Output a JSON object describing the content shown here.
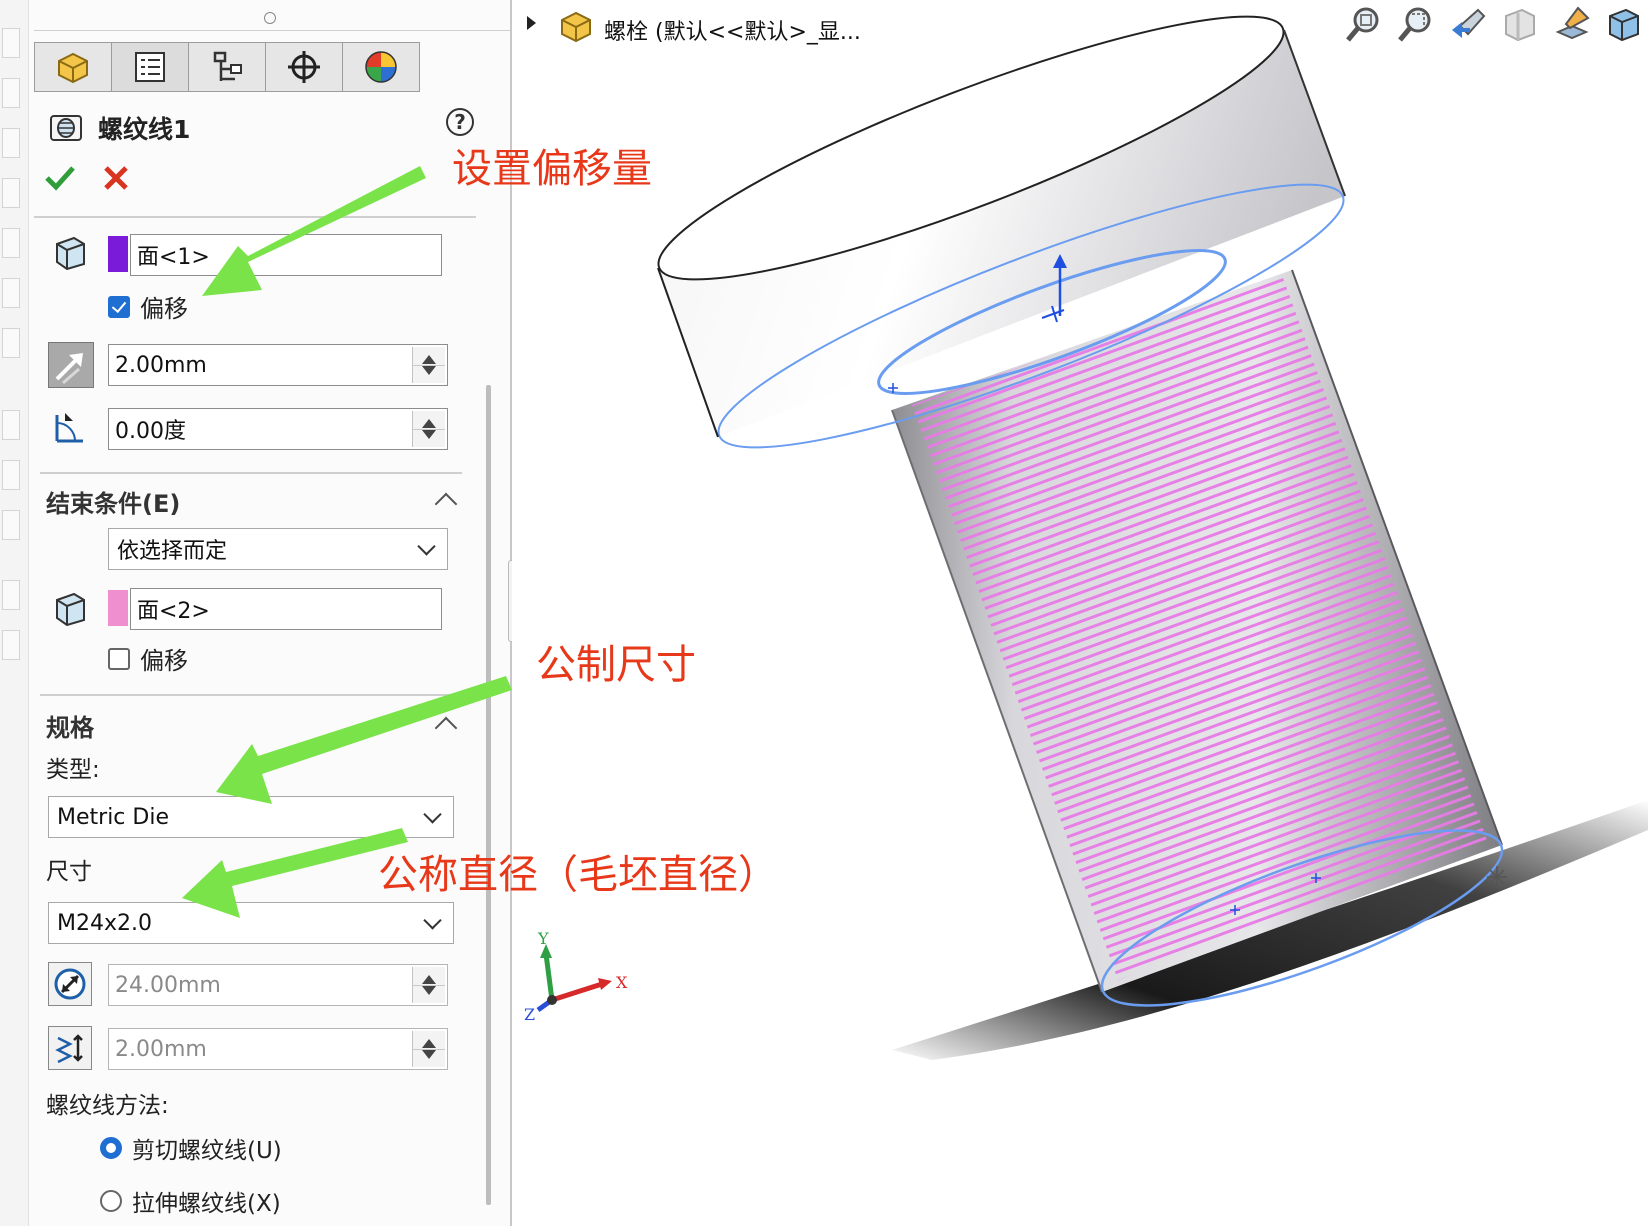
{
  "feature": {
    "title": "螺纹线1",
    "help_icon": "question-icon",
    "ok_icon": "check-icon",
    "cancel_icon": "close-icon"
  },
  "tabs": [
    {
      "icon": "part-icon"
    },
    {
      "icon": "property-manager-icon"
    },
    {
      "icon": "configuration-icon"
    },
    {
      "icon": "crosshair-icon"
    },
    {
      "icon": "appearance-icon"
    }
  ],
  "start": {
    "face_value": "面<1>",
    "face_color": "#7a1bd9",
    "offset_label": "偏移",
    "offset_checked": true,
    "offset_distance": "2.00mm",
    "angle": "0.00度"
  },
  "end_condition": {
    "title": "结束条件(E)",
    "mode": "依选择而定",
    "face_value": "面<2>",
    "face_color": "#ef8fd0",
    "offset_label": "偏移",
    "offset_checked": false
  },
  "spec": {
    "title": "规格",
    "type_label": "类型:",
    "type_value": "Metric Die",
    "size_label": "尺寸",
    "size_value": "M24x2.0",
    "diameter": "24.00mm",
    "pitch": "2.00mm",
    "method_label": "螺纹线方法:",
    "cut_label": "剪切螺纹线(U)",
    "cut_checked": true,
    "extrude_label": "拉伸螺纹线(X)",
    "extrude_checked": false
  },
  "annotations": {
    "offset": "设置偏移量",
    "metric": "公制尺寸",
    "diameter": "公称直径（毛坯直径）",
    "color": "#e8381a",
    "arrow_color": "#7be34a"
  },
  "viewport": {
    "tree_item": "螺栓 (默认<<默认>_显...",
    "tree_icon": "part-icon",
    "toolbar_icons": [
      "zoom-to-fit-icon",
      "zoom-area-icon",
      "previous-view-icon",
      "section-view-icon",
      "view-orientation-icon",
      "display-style-icon"
    ],
    "triad": {
      "x": "X",
      "y": "Y",
      "z": "Z"
    },
    "thread_color": "#e77be6"
  }
}
